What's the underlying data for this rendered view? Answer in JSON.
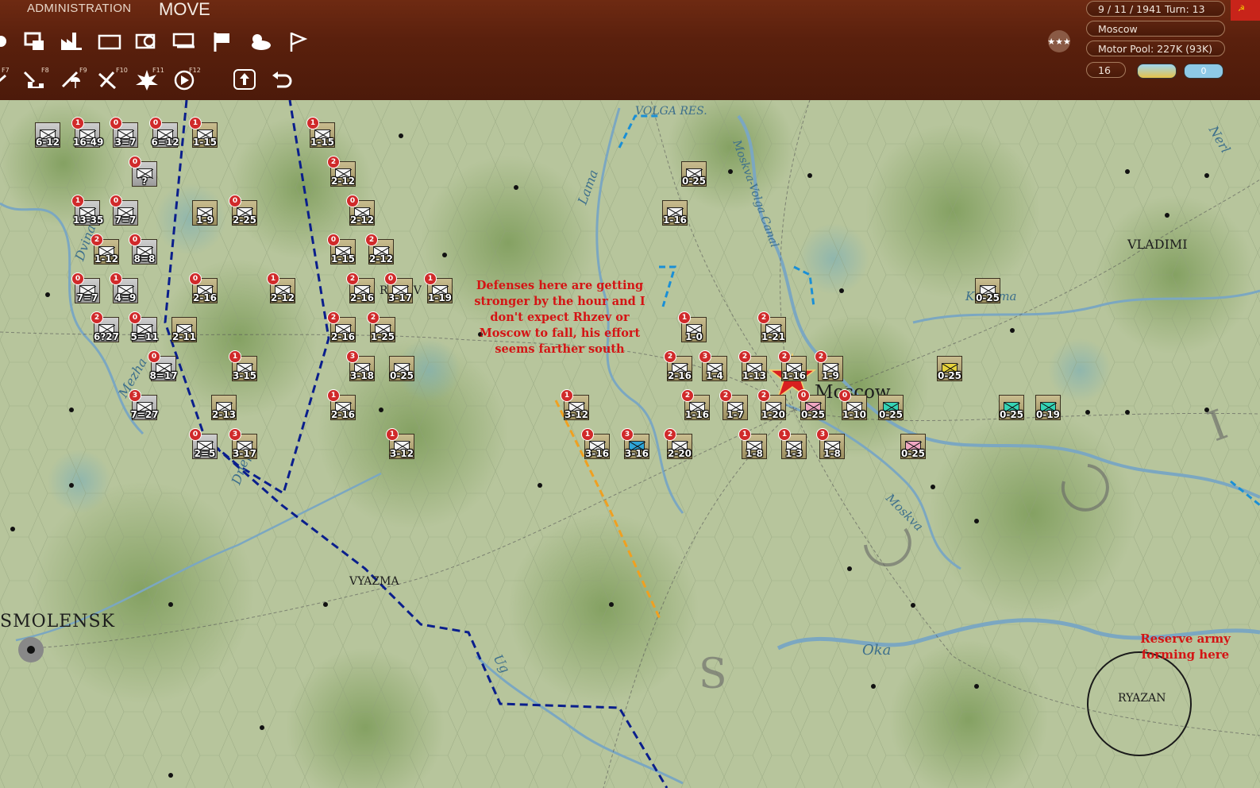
{
  "menu": {
    "admin_label": "ADMINISTRATION",
    "mode_label": "MOVE"
  },
  "info": {
    "date_turn": "9 / 11 / 1941  Turn: 13",
    "location": "Moscow",
    "motor_pool": "Motor Pool:  227K (93K)",
    "supply_value": "16",
    "counter_value": "0"
  },
  "fkeys": [
    "F7",
    "F8",
    "F9",
    "F10",
    "F11",
    "F12"
  ],
  "places": {
    "smolensk": "SMOLENSK",
    "moscow": "Moscow",
    "vladimir": "VLADIMI",
    "vyazma": "VYAZMA",
    "rzhev": "RZHEV",
    "ryazan": "RYAZAN"
  },
  "rivers": {
    "volga_res": "VOLGA RES.",
    "moskva_volga": "Moskva-Volga Canal",
    "lama": "Lama",
    "klyazma": "Klyazma",
    "oka": "Oka",
    "moskva": "Moskva",
    "nerl": "Nerl",
    "mezha": "Mezha",
    "dvina": "Dvina",
    "dnepr": "Dnepr",
    "ugra": "Ug"
  },
  "notes": {
    "defenses": "Defenses here are getting stronger by the hour and I don't expect Rhzev or Moscow to fall, his effort seems farther south",
    "reserve": "Reserve army forming here"
  },
  "colors": {
    "topbar": "#5a200d",
    "note_red": "#d41414",
    "front_line": "#0a1e8c",
    "orange_line": "#f0a020"
  },
  "units": [
    {
      "s": "6-12",
      "c": "grey"
    },
    {
      "s": "16-49",
      "c": "grey",
      "b": "1"
    },
    {
      "s": "3=7",
      "c": "grey",
      "b": "0"
    },
    {
      "s": "6=12",
      "c": "grey",
      "b": "0"
    },
    {
      "s": "1-15",
      "b": "1"
    },
    {
      "s": "1-15",
      "b": "1"
    },
    {
      "s": "?",
      "c": "grey",
      "b": "0"
    },
    {
      "s": "2-12",
      "b": "2"
    },
    {
      "s": "0-25"
    },
    {
      "s": "13-35",
      "c": "grey",
      "b": "1"
    },
    {
      "s": "7=7",
      "c": "grey",
      "b": "0"
    },
    {
      "s": "1-9"
    },
    {
      "s": "2-25",
      "b": "0"
    },
    {
      "s": "2-12",
      "b": "0"
    },
    {
      "s": "1-16"
    },
    {
      "s": "1-12",
      "b": "2"
    },
    {
      "s": "8=8",
      "c": "grey",
      "b": "0"
    },
    {
      "s": "1-15",
      "b": "0"
    },
    {
      "s": "2-12",
      "b": "2"
    },
    {
      "s": "7=7",
      "c": "grey",
      "b": "0"
    },
    {
      "s": "4=9",
      "c": "grey",
      "b": "1"
    },
    {
      "s": "2-16",
      "b": "0"
    },
    {
      "s": "2-12",
      "b": "1"
    },
    {
      "s": "2-16",
      "b": "2"
    },
    {
      "s": "3-17",
      "b": "0"
    },
    {
      "s": "1-19",
      "b": "1"
    },
    {
      "s": "0-25"
    },
    {
      "s": "6?27",
      "c": "grey",
      "b": "2"
    },
    {
      "s": "5=11",
      "c": "grey",
      "b": "0"
    },
    {
      "s": "2-11"
    },
    {
      "s": "2-16",
      "b": "2"
    },
    {
      "s": "1-25",
      "b": "2"
    },
    {
      "s": "1-0",
      "b": "1"
    },
    {
      "s": "1-21",
      "b": "2"
    },
    {
      "s": "8=17",
      "c": "grey",
      "b": "0"
    },
    {
      "s": "3-15",
      "b": "1"
    },
    {
      "s": "3-18",
      "b": "3"
    },
    {
      "s": "0-25"
    },
    {
      "s": "2-16",
      "b": "2"
    },
    {
      "s": "1-4",
      "b": "3"
    },
    {
      "s": "1-13",
      "b": "2"
    },
    {
      "s": "1-16",
      "b": "2"
    },
    {
      "s": "1-9",
      "b": "2"
    },
    {
      "s": "0-25",
      "c": "yellow"
    },
    {
      "s": "7=27",
      "c": "grey",
      "b": "3"
    },
    {
      "s": "2-13"
    },
    {
      "s": "2-16",
      "b": "1"
    },
    {
      "s": "3-12",
      "b": "1"
    },
    {
      "s": "1-16",
      "b": "2"
    },
    {
      "s": "1-7",
      "b": "2"
    },
    {
      "s": "1-20",
      "b": "2"
    },
    {
      "s": "0-25",
      "c": "pink",
      "b": "0"
    },
    {
      "s": "1-10",
      "b": "0"
    },
    {
      "s": "0-25",
      "c": "cyan"
    },
    {
      "s": "0-25",
      "c": "cyan"
    },
    {
      "s": "0-19",
      "c": "cyan"
    },
    {
      "s": "2=5",
      "c": "grey",
      "b": "0"
    },
    {
      "s": "3-17",
      "b": "3"
    },
    {
      "s": "3-12",
      "b": "1"
    },
    {
      "s": "3-16",
      "b": "1"
    },
    {
      "s": "3-16",
      "c": "blue",
      "b": "3"
    },
    {
      "s": "2-20",
      "b": "2"
    },
    {
      "s": "1-8",
      "b": "1"
    },
    {
      "s": "1-3",
      "b": "1"
    },
    {
      "s": "1-8",
      "b": "3"
    },
    {
      "s": "0-25",
      "c": "pink"
    }
  ]
}
